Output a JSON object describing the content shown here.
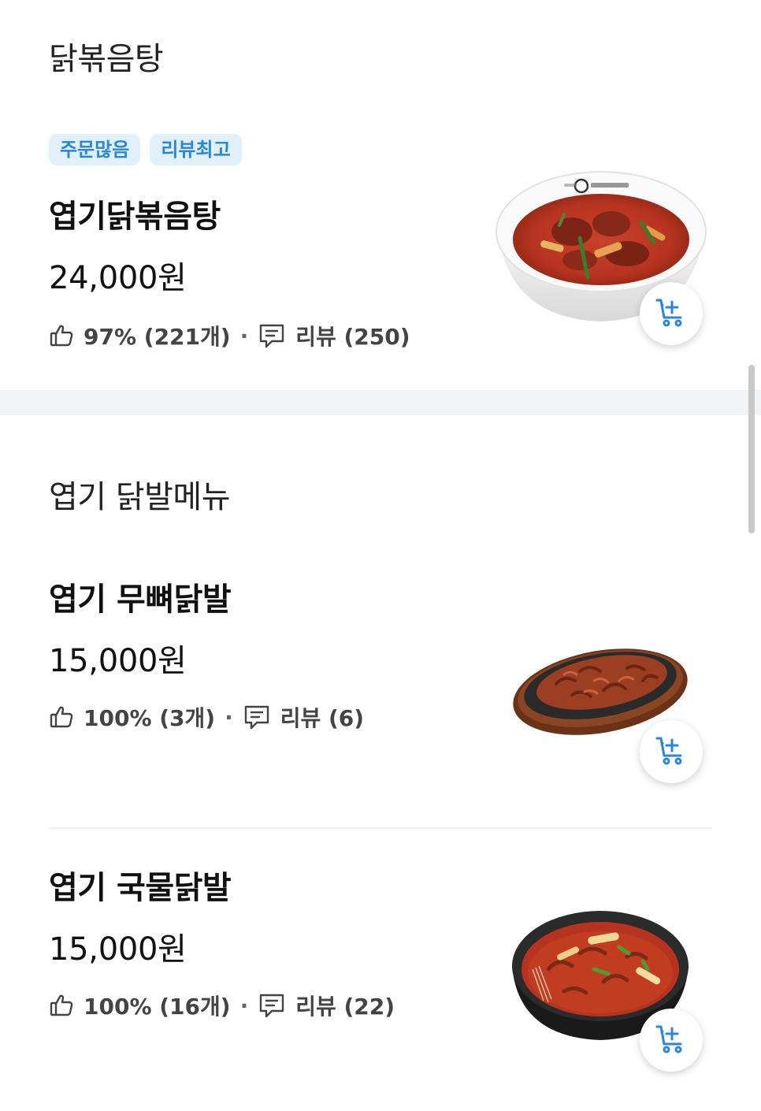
{
  "sections": [
    {
      "title": "닭볶음탕",
      "items": [
        {
          "badges": [
            "주문많음",
            "리뷰최고"
          ],
          "name": "엽기닭볶음탕",
          "price": "24,000원",
          "likes": "97% (221개)",
          "dot": "·",
          "reviews": "리뷰 (250)"
        }
      ]
    },
    {
      "title": "엽기 닭발메뉴",
      "items": [
        {
          "name": "엽기 무뼈닭발",
          "price": "15,000원",
          "likes": "100% (3개)",
          "dot": "·",
          "reviews": "리뷰 (6)"
        },
        {
          "name": "엽기 국물닭발",
          "price": "15,000원",
          "likes": "100% (16개)",
          "dot": "·",
          "reviews": "리뷰 (22)"
        }
      ]
    }
  ],
  "icons": {
    "like": "thumbs-up-icon",
    "review": "speech-bubble-icon",
    "cart": "add-to-cart-icon"
  },
  "colors": {
    "badge_bg": "#e2f0fc",
    "badge_text": "#2a86d8",
    "cart_icon": "#2a86d8",
    "section_divider": "#f3f4f6"
  }
}
